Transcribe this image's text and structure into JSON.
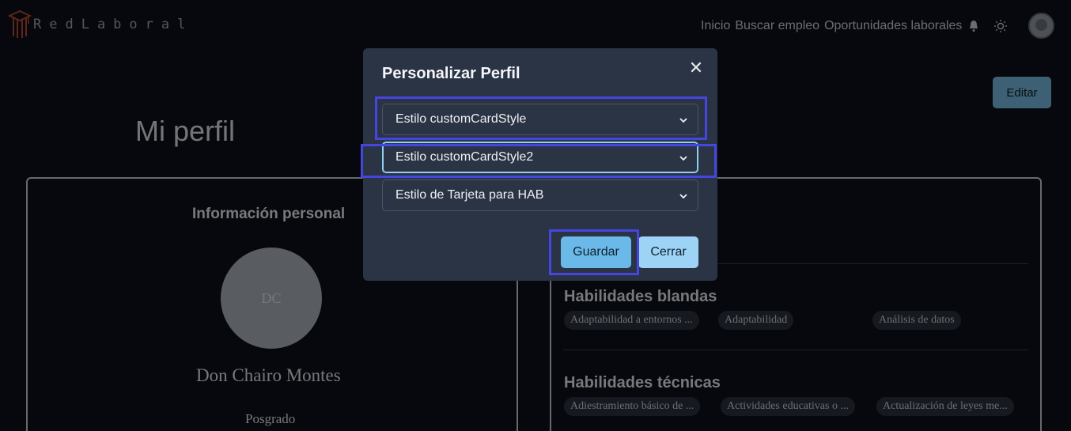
{
  "header": {
    "logo_text": "RedLaboral",
    "nav": [
      "Inicio",
      "Buscar empleo",
      "Oportunidades laborales"
    ],
    "icons": [
      "bell-icon",
      "sun-icon"
    ]
  },
  "page": {
    "title": "Mi perfil",
    "edit_label": "Editar",
    "personal_info_title": "Información personal",
    "initials": "DC",
    "full_name": "Don Chairo Montes",
    "degree": "Posgrado",
    "soft_skills_title": "Habilidades blandas",
    "soft_skills": [
      "Adaptabilidad a entornos ...",
      "Adaptabilidad",
      "Análisis de datos"
    ],
    "tech_skills_title": "Habilidades técnicas",
    "tech_skills": [
      "Adiestramiento básico de ...",
      "Actividades educativas o ...",
      "Actualización de leyes me..."
    ]
  },
  "modal": {
    "title": "Personalizar Perfil",
    "close_symbol": "✕",
    "selects": [
      "Estilo customCardStyle",
      "Estilo customCardStyle2",
      "Estilo de Tarjeta para HAB"
    ],
    "save_label": "Guardar",
    "close_label": "Cerrar"
  },
  "colors": {
    "background": "#0c111c",
    "modal": "#2b3445",
    "accent": "#6ab9e8",
    "highlight": "#4545e0"
  }
}
